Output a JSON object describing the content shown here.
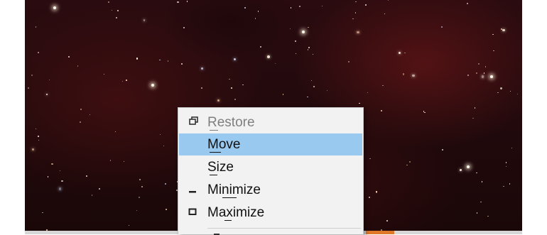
{
  "system_menu": {
    "items": [
      {
        "label": "Restore",
        "mnemonic": "R",
        "icon": "restore-icon",
        "state": "disabled"
      },
      {
        "label": "Move",
        "mnemonic": "M",
        "icon": "",
        "state": "highlighted"
      },
      {
        "label": "Size",
        "mnemonic": "S",
        "icon": "",
        "state": "normal"
      },
      {
        "label": "Minimize",
        "mnemonic": "n",
        "icon": "minimize-icon",
        "state": "normal"
      },
      {
        "label": "Maximize",
        "mnemonic": "x",
        "icon": "maximize-icon",
        "state": "normal"
      }
    ]
  },
  "colors": {
    "highlight": "#99c9ef",
    "menu_background": "#f2f2f2",
    "disabled_text": "#7f7f7f",
    "taskbar_accent": "#e0782a"
  }
}
